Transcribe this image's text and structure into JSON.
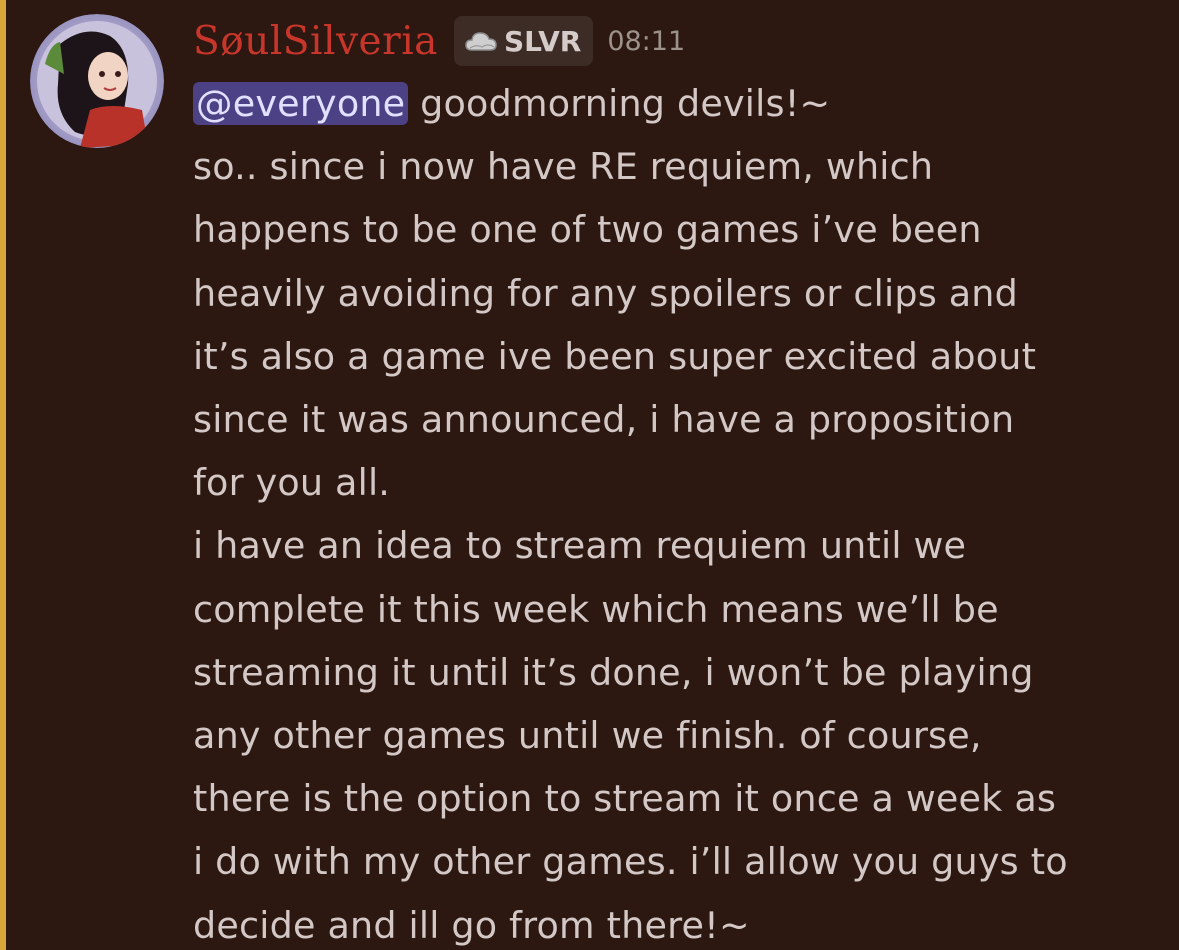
{
  "message": {
    "author": {
      "username": "SøulSilveria",
      "tag": "SLVR",
      "tag_icon": "cloud-icon",
      "avatar": "avatar"
    },
    "timestamp": "08:11",
    "mention": "@everyone",
    "lines": [
      " goodmorning devils!~",
      "so.. since i now have RE requiem, which",
      "happens to be one of two games i’ve been",
      "heavily avoiding for any spoilers or clips and",
      "it’s also a game ive been super excited about",
      "since it was announced, i have a proposition",
      "for you all.",
      "i have an idea to stream requiem until we",
      "complete it this week which means we’ll be",
      "streaming it until it’s done, i won’t be playing",
      "any other games until we finish. of course,",
      "there is the option to stream it once a week as",
      "i do with my other games. i’ll allow you guys to",
      "decide and ill go from there!~"
    ]
  },
  "colors": {
    "background": "#2c1811",
    "mention_highlight_bar": "#d8a53a",
    "username": "#c8362b",
    "text": "#d3c8c6",
    "mention_bg": "#4c4184",
    "timestamp": "#9d918c"
  }
}
